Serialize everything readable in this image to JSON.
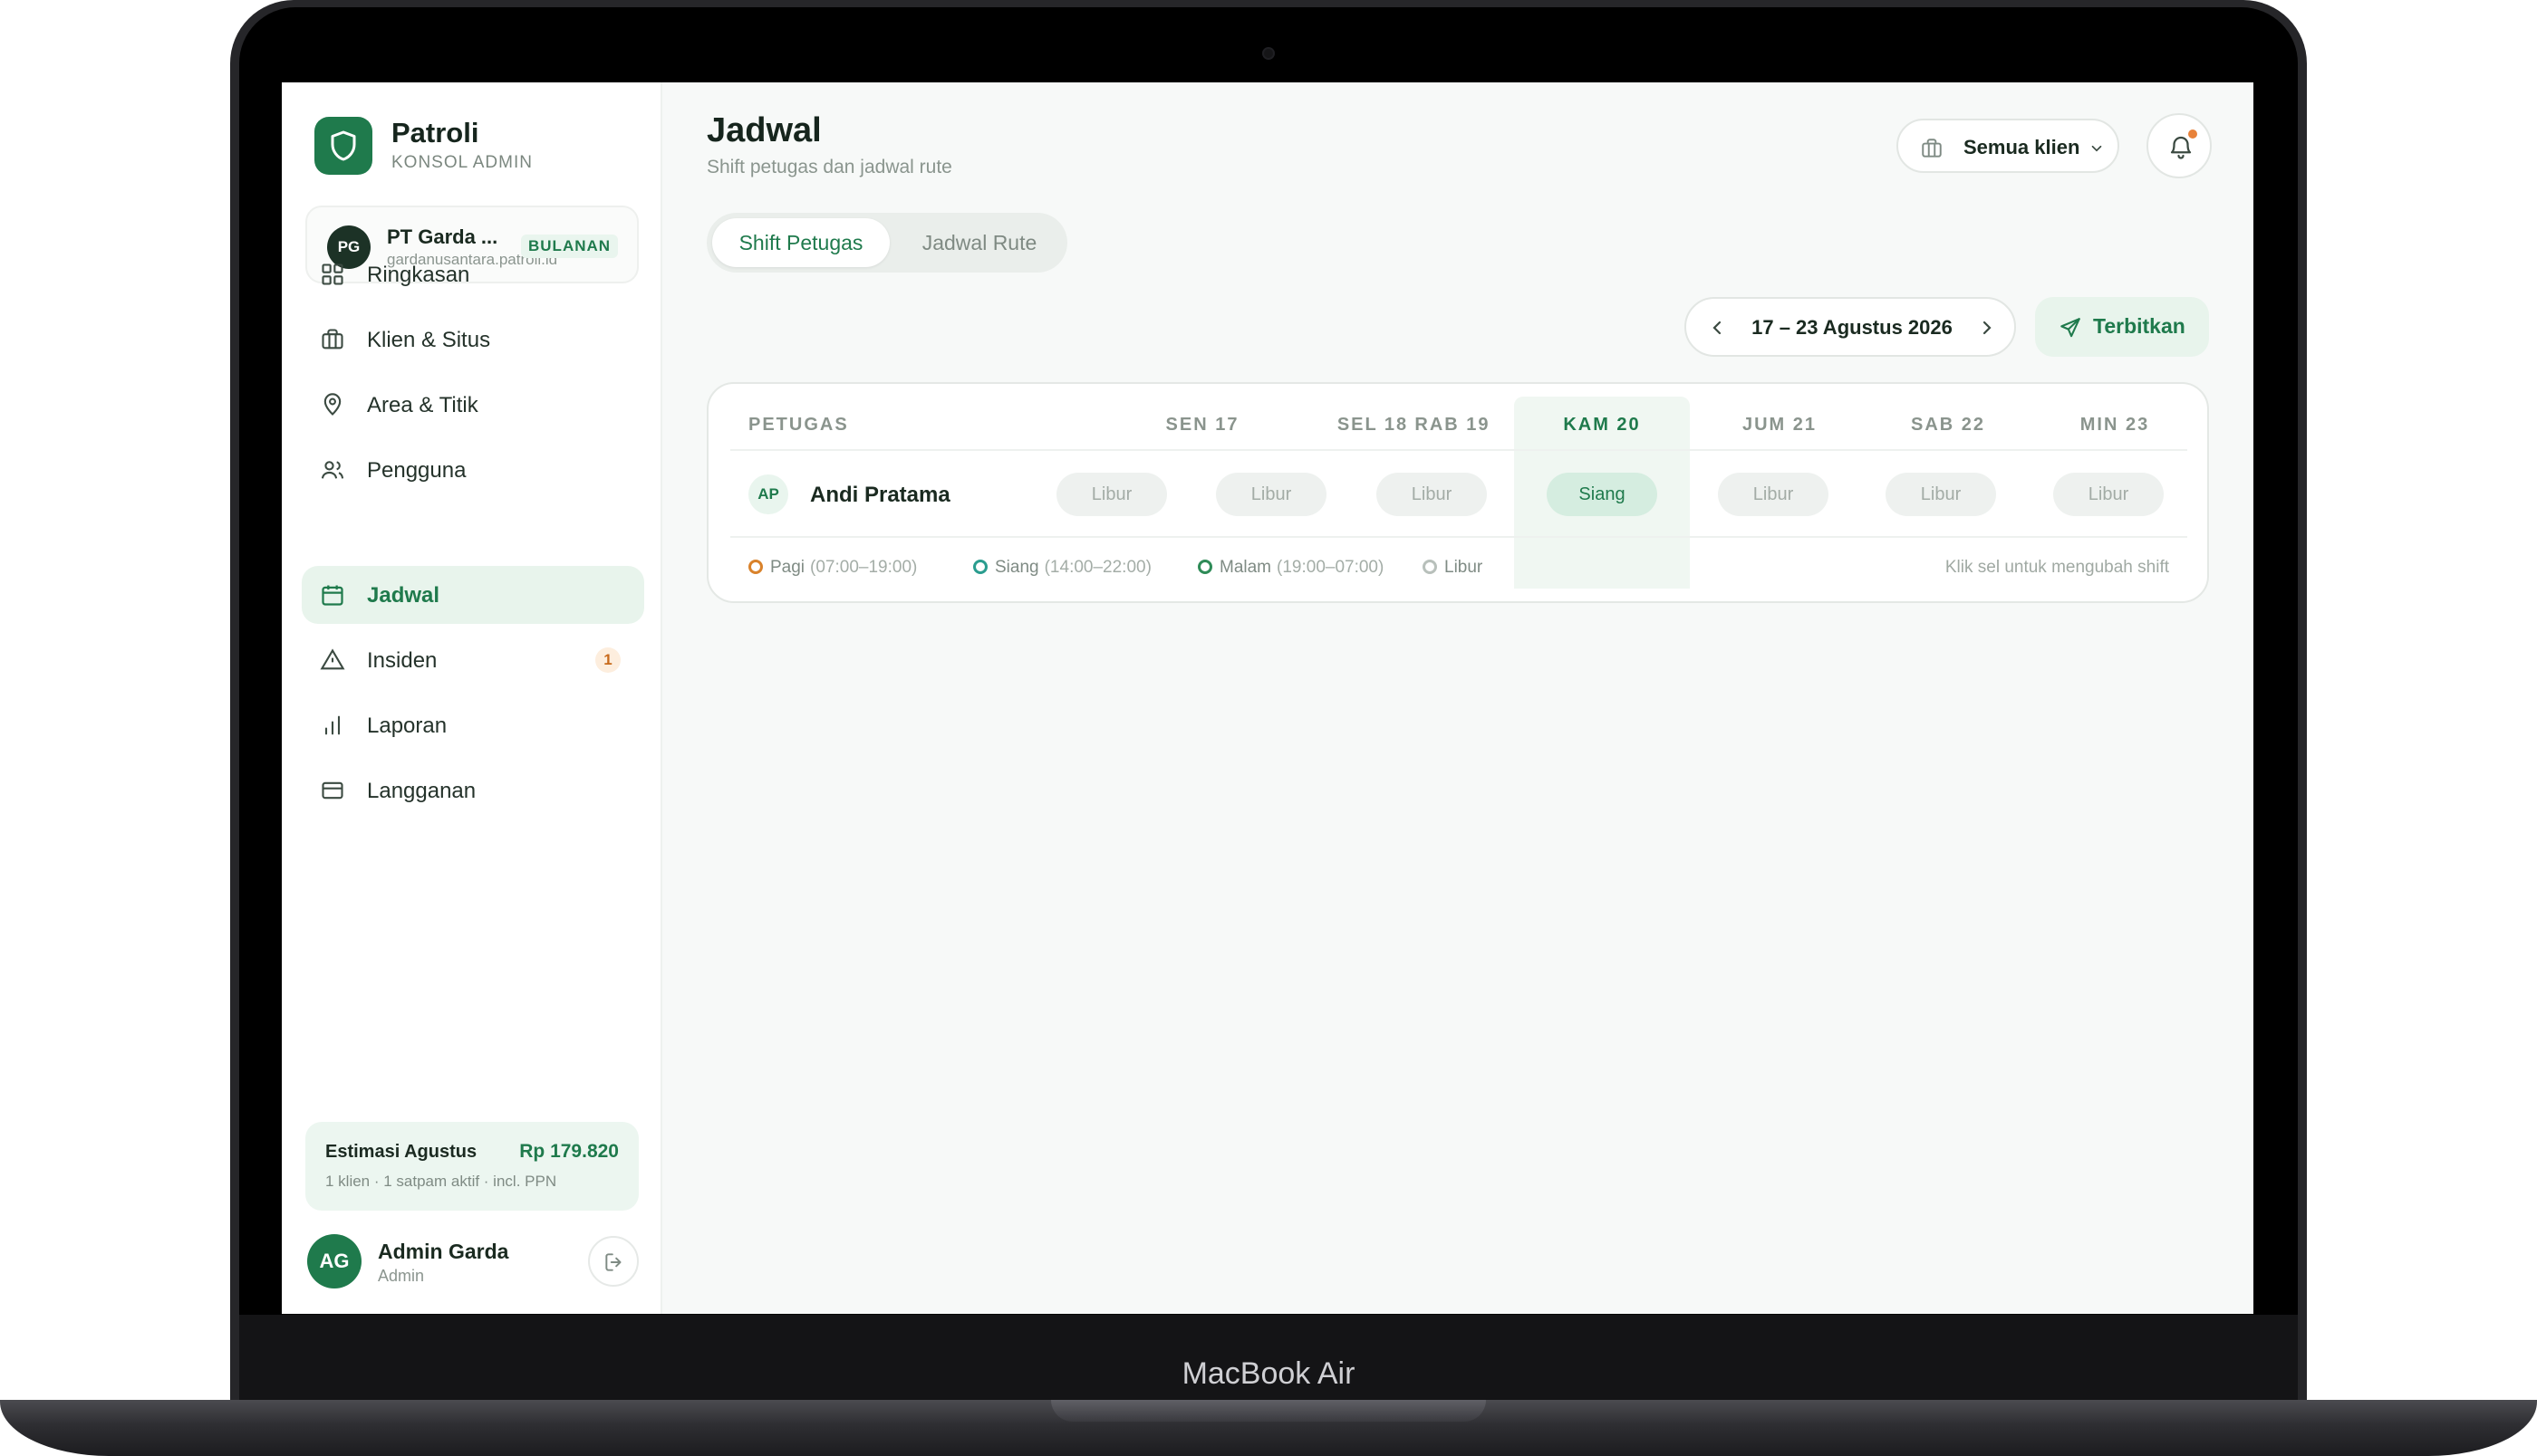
{
  "device": {
    "name": "MacBook Air"
  },
  "brand": {
    "name": "Patroli",
    "subtitle": "KONSOL ADMIN"
  },
  "client": {
    "initials": "PG",
    "name": "PT Garda ...",
    "url": "gardanusantara.patroli.id",
    "plan": "BULANAN"
  },
  "sidebar": {
    "items": [
      {
        "label": "Ringkasan",
        "icon": "grid-icon"
      },
      {
        "label": "Klien & Situs",
        "icon": "briefcase-icon"
      },
      {
        "label": "Area & Titik",
        "icon": "map-pin-icon"
      },
      {
        "label": "Pengguna",
        "icon": "users-icon"
      },
      {
        "label": "Jadwal",
        "icon": "calendar-icon",
        "active": true
      },
      {
        "label": "Insiden",
        "icon": "alert-triangle-icon",
        "badge": "1"
      },
      {
        "label": "Laporan",
        "icon": "bar-chart-icon"
      },
      {
        "label": "Langganan",
        "icon": "credit-card-icon"
      }
    ]
  },
  "estimate": {
    "title": "Estimasi Agustus",
    "value": "Rp 179.820",
    "detail": "1 klien · 1 satpam aktif · incl. PPN"
  },
  "user": {
    "initials": "AG",
    "name": "Admin Garda",
    "role": "Admin"
  },
  "header": {
    "title": "Jadwal",
    "subtitle": "Shift petugas dan jadwal rute",
    "client_filter": "Semua klien"
  },
  "tabs": [
    {
      "label": "Shift Petugas",
      "active": true
    },
    {
      "label": "Jadwal Rute",
      "active": false
    }
  ],
  "week": {
    "range": "17 – 23 Agustus 2026"
  },
  "publish_label": "Terbitkan",
  "schedule": {
    "officer_header": "PETUGAS",
    "days": [
      "SEN 17",
      "SEL 18",
      "RAB 19",
      "KAM 20",
      "JUM 21",
      "SAB 22",
      "MIN 23"
    ],
    "today_index": 3,
    "rows": [
      {
        "initials": "AP",
        "name": "Andi Pratama",
        "shifts": [
          "Libur",
          "Libur",
          "Libur",
          "Siang",
          "Libur",
          "Libur",
          "Libur"
        ]
      }
    ]
  },
  "legend": [
    {
      "label": "Pagi",
      "time": "(07:00–19:00)",
      "color": "#d9822b"
    },
    {
      "label": "Siang",
      "time": "(14:00–22:00)",
      "color": "#2a9d8f"
    },
    {
      "label": "Malam",
      "time": "(19:00–07:00)",
      "color": "#2e8b57"
    },
    {
      "label": "Libur",
      "time": "",
      "color": "#b8c0bb"
    }
  ],
  "hint": "Klik sel untuk mengubah shift",
  "colors": {
    "accent": "#1f7a4c",
    "accent_soft": "#e8f4ec",
    "badge": "#e8823a"
  }
}
